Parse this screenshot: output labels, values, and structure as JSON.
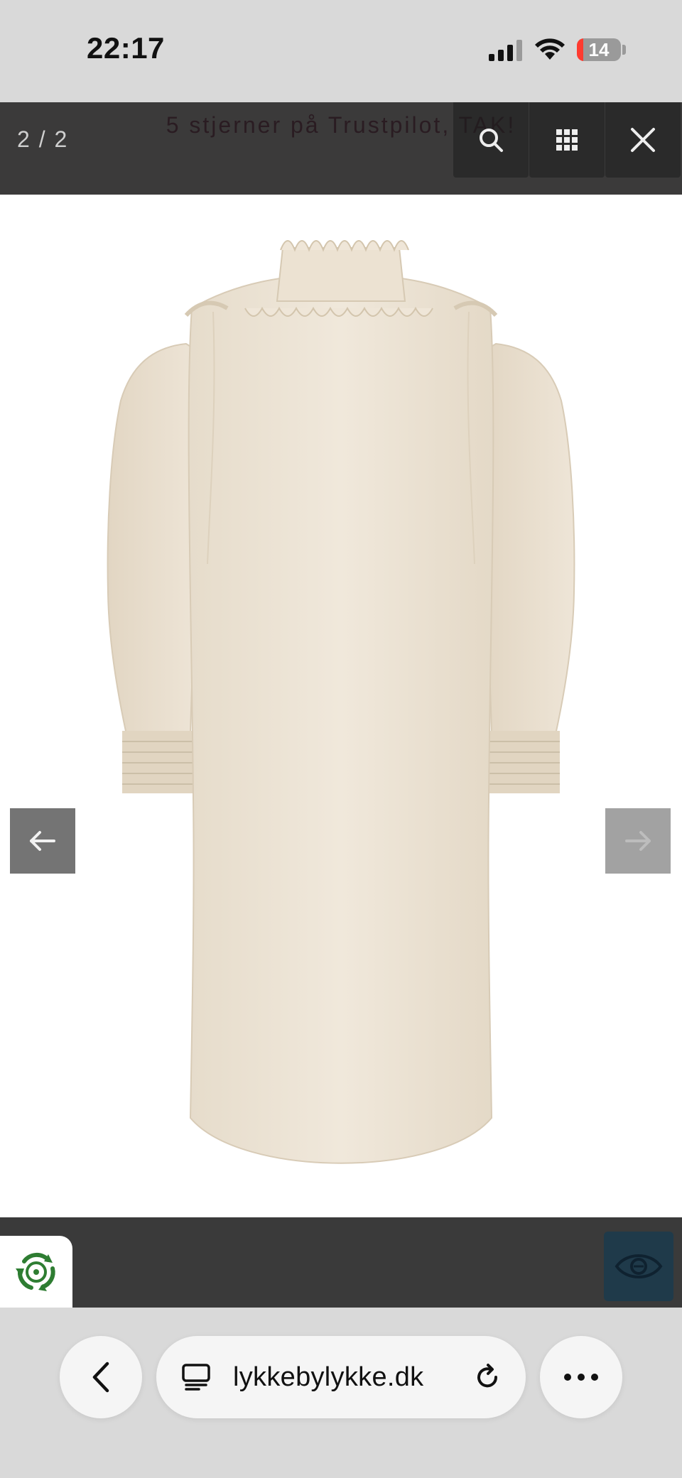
{
  "status_bar": {
    "time": "22:17",
    "battery_level": "14",
    "battery_fraction": 0.14
  },
  "lightbox": {
    "counter": "2 / 2",
    "announcement": "5 stjerner på Trustpilot, TAK!",
    "buttons": {
      "search": "search-icon",
      "grid": "grid-icon",
      "close": "close-icon"
    },
    "prev_icon": "arrow-left-icon",
    "next_icon": "arrow-right-icon",
    "product_color": "#ece3d4"
  },
  "browser": {
    "url": "lykkebylykke.dk",
    "back_icon": "chevron-left-icon",
    "reader_icon": "reader-mode-icon",
    "reload_icon": "reload-icon",
    "more_icon": "more-icon"
  },
  "colors": {
    "accent_badge": "#1f3a4a",
    "recycle_green": "#2e7d32",
    "battery_red": "#ff3b30"
  }
}
